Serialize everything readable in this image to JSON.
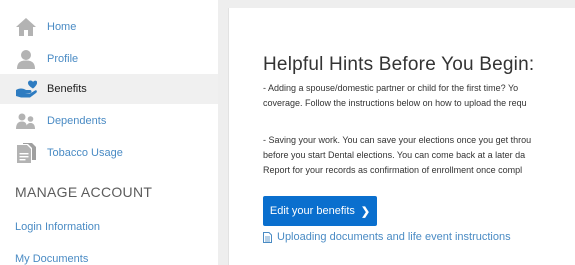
{
  "sidebar": {
    "items": [
      {
        "label": "Home",
        "icon": "home-icon",
        "active": false
      },
      {
        "label": "Profile",
        "icon": "user-icon",
        "active": false
      },
      {
        "label": "Benefits",
        "icon": "heart-hand-icon",
        "active": true
      },
      {
        "label": "Dependents",
        "icon": "dependents-icon",
        "active": false
      },
      {
        "label": "Tobacco Usage",
        "icon": "document-icon",
        "active": false
      }
    ],
    "section_title": "MANAGE ACCOUNT",
    "links": [
      "Login Information",
      "My Documents"
    ]
  },
  "main": {
    "title": "Helpful Hints Before You Begin:",
    "para1": [
      "- Adding a spouse/domestic partner or child for the first time? Yo",
      "coverage. Follow the instructions below on how to upload the requ"
    ],
    "para2": [
      "- Saving your work. You can save your elections once you get throu",
      "before you start Dental elections. You can come back at a later da",
      "Report for your records as confirmation of enrollment once compl"
    ],
    "button_label": "Edit your benefits",
    "button_chevron": "❯",
    "doc_link_label": "Uploading documents and life event instructions"
  },
  "colors": {
    "link": "#4a8bc4",
    "button": "#0a6fce",
    "active_bg": "#f0f0f0",
    "icon_gray": "#b3b3b3",
    "benefits_icon": "#2e7cc1"
  }
}
